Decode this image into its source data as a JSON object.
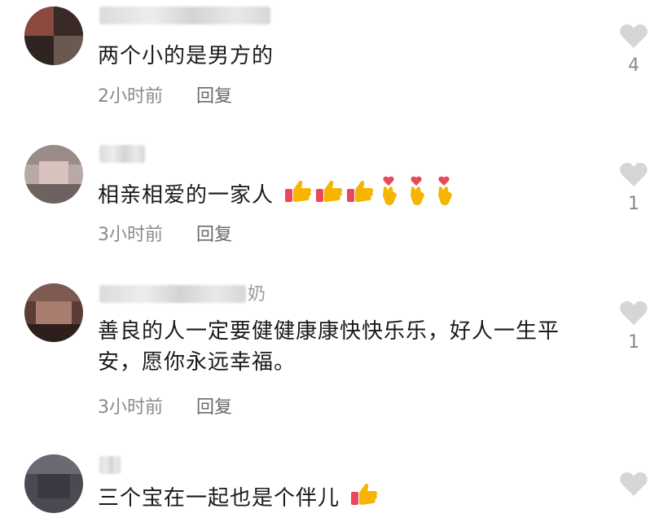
{
  "comments": [
    {
      "username_visible": "",
      "username_suffix": "",
      "text": "两个小的是男方的",
      "time": "2小时前",
      "reply_label": "回复",
      "likes": "4",
      "emojis": []
    },
    {
      "username_visible": "",
      "username_suffix": "",
      "text": "相亲相爱的一家人",
      "time": "3小时前",
      "reply_label": "回复",
      "likes": "1",
      "emojis": [
        "thumbs-up",
        "thumbs-up",
        "thumbs-up",
        "finger-heart",
        "finger-heart",
        "finger-heart"
      ]
    },
    {
      "username_visible": "",
      "username_suffix": "奶",
      "text": "善良的人一定要健健康康快快乐乐，好人一生平安，愿你永远幸福。",
      "time": "3小时前",
      "reply_label": "回复",
      "likes": "1",
      "emojis": []
    },
    {
      "username_visible": "",
      "username_suffix": "",
      "text": "三个宝在一起也是个伴儿",
      "time": "",
      "reply_label": "",
      "likes": "",
      "emojis": [
        "thumbs-up"
      ]
    }
  ],
  "colors": {
    "like_heart": "#d6d6d6",
    "meta_text": "#8a8a8a",
    "body_text": "#1a1a1a"
  }
}
